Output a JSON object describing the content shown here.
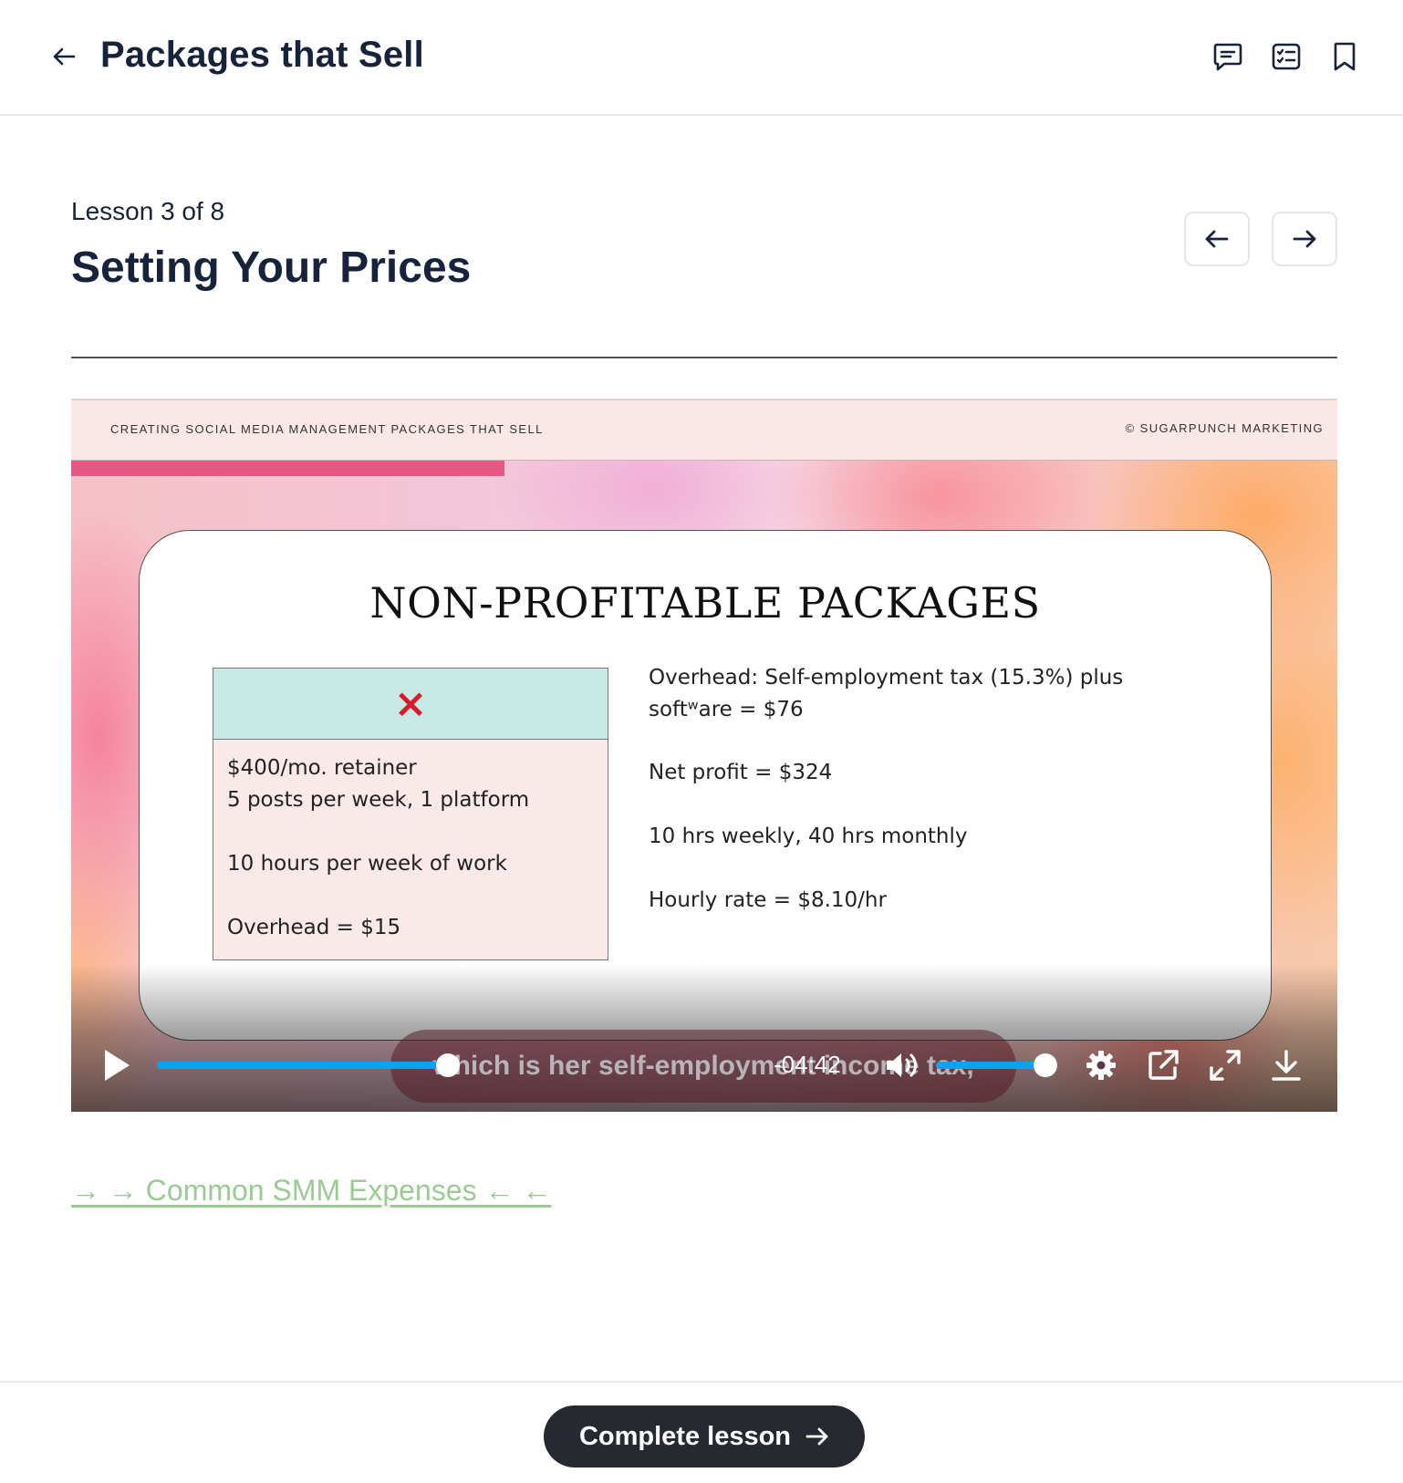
{
  "header": {
    "course_title": "Packages that Sell",
    "icons": [
      "back-arrow-icon",
      "comments-icon",
      "checklist-icon",
      "bookmark-icon"
    ]
  },
  "lesson": {
    "meta": "Lesson 3 of 8",
    "title": "Setting Your Prices"
  },
  "video": {
    "slide_header_left": "CREATING SOCIAL MEDIA MANAGEMENT PACKAGES THAT SELL",
    "slide_header_right": "© SUGARPUNCH MARKETING",
    "slide_title": "NON-PROFITABLE PACKAGES",
    "box_mark": "×",
    "box_lines": [
      "$400/mo. retainer",
      "5 posts per week, 1 platform",
      "10 hours per week of work",
      "Overhead = $15"
    ],
    "right_lines": [
      "Overhead: Self-employment tax (15.3%) plus",
      "softʷare = $76",
      "Net profit = $324",
      "10 hrs weekly, 40 hrs monthly",
      "Hourly rate = $8.10/hr"
    ],
    "caption": "which is her self-employment income tax,",
    "time_remaining": "-04:42",
    "progress_fraction": 0.28,
    "volume_fraction": 1.0,
    "colors": {
      "accent": "#0aa3f0",
      "slide_bar": "#e65783",
      "box_header": "#c8eae6",
      "x_mark": "#d81b2a"
    }
  },
  "resource_link": "→ → Common SMM Expenses ← ←",
  "footer": {
    "complete_label": "Complete lesson"
  }
}
